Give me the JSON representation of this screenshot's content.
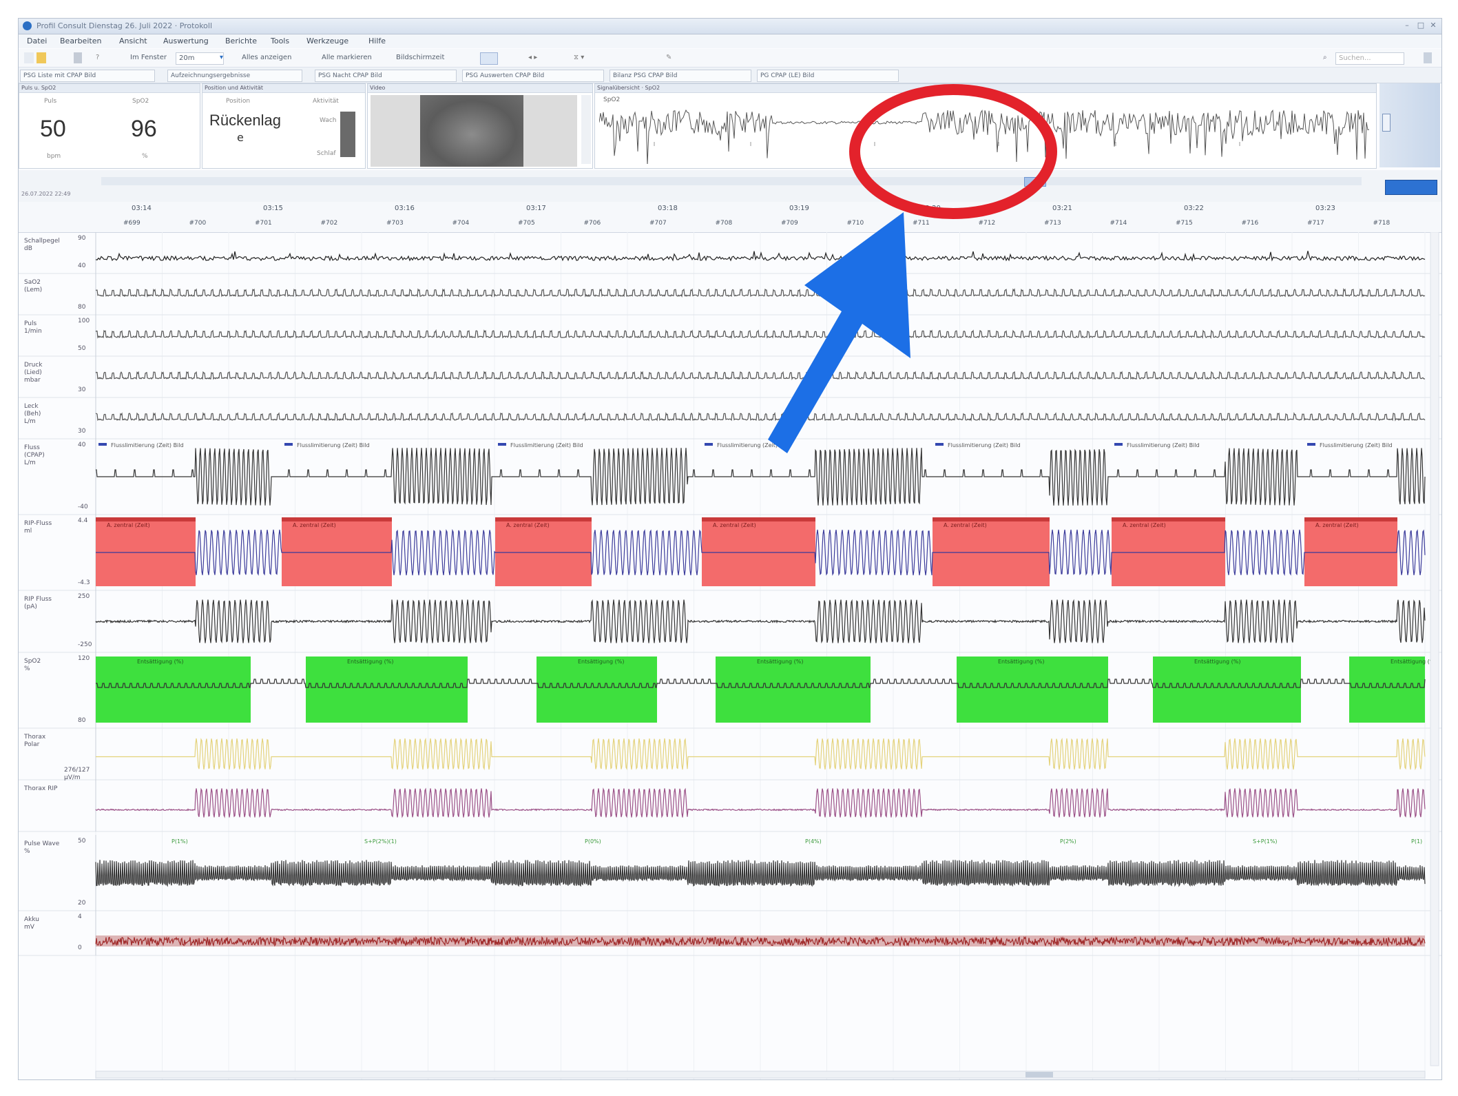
{
  "window": {
    "title": "Profil Consult Dienstag 26. Juli 2022 · Protokoll"
  },
  "menu": [
    "Datei",
    "Bearbeiten",
    "Ansicht",
    "Auswertung",
    "Berichte",
    "Tools",
    "Werkzeuge",
    "Hilfe"
  ],
  "toolbar": {
    "zoom_label": "Im Fenster",
    "zoom_value": "20m",
    "show_all": "Alles anzeigen",
    "mark_all": "Alle markieren",
    "screenshot": "Bildschirmzeit",
    "search_placeholder": "Suchen..."
  },
  "tabs": [
    "PSG Liste mit CPAP Bild",
    "Aufzeichnungsergebnisse",
    "PSG Nacht CPAP Bild",
    "PSG Auswerten CPAP Bild",
    "Bilanz PSG CPAP Bild",
    "PG CPAP (LE) Bild"
  ],
  "panels": {
    "pulse": {
      "title": "Puls u. SpO2",
      "pulse_label": "Puls",
      "pulse_value": "50",
      "pulse_unit": "bpm",
      "spo2_label": "SpO2",
      "spo2_value": "96",
      "spo2_unit": "%"
    },
    "position": {
      "title": "Position und Aktivität",
      "position_label": "Position",
      "position_value": "Rückenlag",
      "position_sub": "e",
      "activity_label": "Aktivität",
      "wake": "Wach",
      "sleep": "Schlaf"
    },
    "video": {
      "title": "Video"
    },
    "signal": {
      "title": "Signalübersicht · SpO2",
      "legend": "SpO2"
    }
  },
  "timeaxis": {
    "date": "26.07.2022 22:49",
    "times": [
      "03:14",
      "03:15",
      "03:16",
      "03:17",
      "03:18",
      "03:19",
      "03:20",
      "03:21",
      "03:22",
      "03:23"
    ],
    "epochs": [
      "#699",
      "#700",
      "#701",
      "#702",
      "#703",
      "#704",
      "#705",
      "#706",
      "#707",
      "#708",
      "#709",
      "#710",
      "#711",
      "#712",
      "#713",
      "#714",
      "#715",
      "#716",
      "#717",
      "#718"
    ]
  },
  "channels": [
    {
      "name": "Schallpegel\ndB",
      "scale_top": "90",
      "scale_bot": "40"
    },
    {
      "name": "SaO2\n(Lem)",
      "scale_top": "",
      "scale_bot": "80"
    },
    {
      "name": "Puls\n1/min",
      "scale_top": "100",
      "scale_bot": "50"
    },
    {
      "name": "Druck\n(Lied)\nmbar",
      "scale_top": "",
      "scale_bot": "30"
    },
    {
      "name": "Leck\n(Beh)\nL/m",
      "scale_top": "",
      "scale_bot": "30"
    },
    {
      "name": "Fluss\n(CPAP)\nL/m",
      "scale_top": "40",
      "scale_bot": "-40"
    },
    {
      "name": "RIP-Fluss\nml",
      "scale_top": "4.4",
      "scale_bot": "-4.3"
    },
    {
      "name": "RIP Fluss\n(pA)",
      "scale_top": "250",
      "scale_bot": "-250"
    },
    {
      "name": "SpO2\n%",
      "scale_top": "120",
      "scale_bot": "80"
    },
    {
      "name": "Thorax\nPolar",
      "scale_top": "",
      "scale_bot": ""
    },
    {
      "name": "Thorax RIP",
      "scale_top": "",
      "scale_bot": ""
    },
    {
      "name": "Pulse Wave\n%",
      "scale_top": "50",
      "scale_bot": "20"
    },
    {
      "name": "Akku\nmV",
      "scale_top": "4",
      "scale_bot": "0"
    }
  ],
  "events": {
    "flow_label": "Flusslimitierung (Zeit) Bild",
    "rip_label": "A. zentral (Zeit)",
    "spo2_label": "Entsättigung (%)",
    "thorax_scale": "276/127\nµV/m",
    "pulse_wave_labels": [
      "P(1%)",
      "S+P(2%)(1)",
      "P(0%)",
      "P(4%)",
      "P(2%)",
      "S+P(1%)",
      "P(1)"
    ]
  },
  "colors": {
    "apnea": "#f36b6b",
    "desat": "#3ee03e",
    "thorax": "#e4d27a",
    "thorax_rip": "#9a4f86",
    "annotation_circle": "#e3222b",
    "annotation_arrow": "#1c6fe6",
    "flow_event": "#3448b0"
  }
}
